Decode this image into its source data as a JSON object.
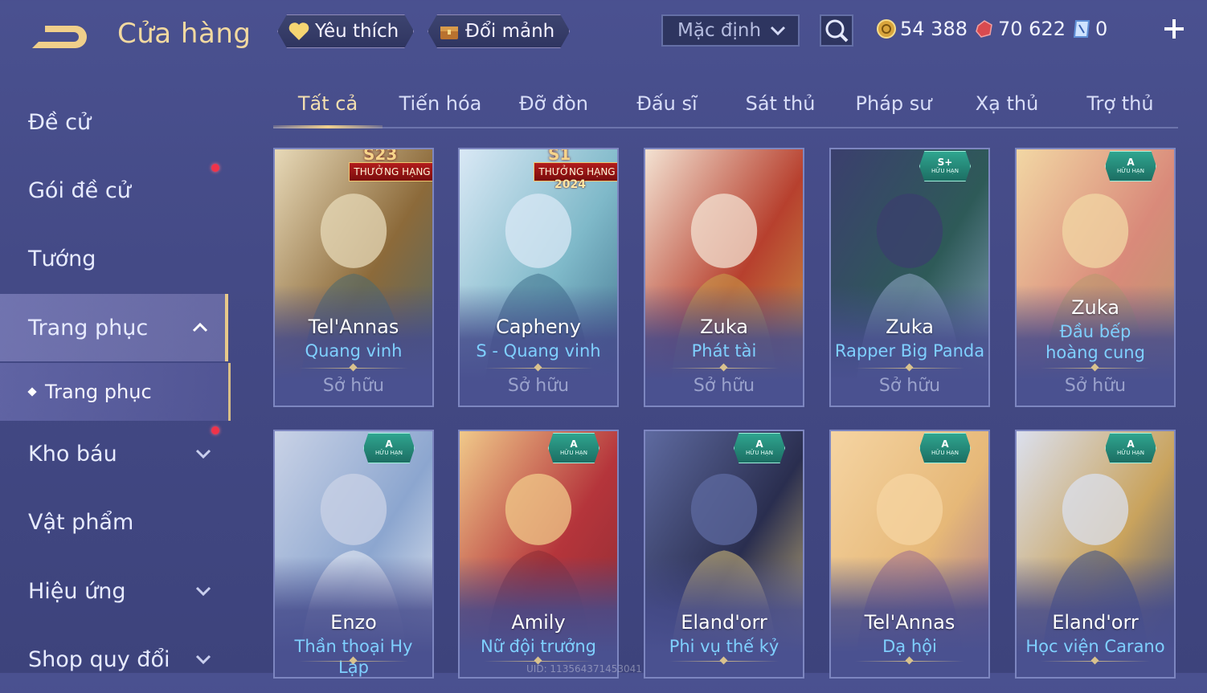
{
  "header": {
    "title": "Cửa hàng",
    "favorite_label": "Yêu thích",
    "exchange_label": "Đổi mảnh",
    "sort_value": "Mặc định",
    "currencies": [
      {
        "icon": "gold-coin-icon",
        "value": "54 388"
      },
      {
        "icon": "ruby-gem-icon",
        "value": "70 622"
      },
      {
        "icon": "voucher-icon",
        "value": "0"
      }
    ]
  },
  "sidebar": {
    "items": [
      {
        "label": "Đề cử"
      },
      {
        "label": "Gói đề cử"
      },
      {
        "label": "Tướng"
      },
      {
        "label": "Trang phục"
      },
      {
        "label": "Kho báu"
      },
      {
        "label": "Vật phẩm"
      },
      {
        "label": "Hiệu ứng"
      },
      {
        "label": "Shop quy đổi"
      }
    ],
    "sub_item": "Trang phục"
  },
  "tabs": [
    "Tất cả",
    "Tiến hóa",
    "Đỡ đòn",
    "Đấu sĩ",
    "Sát thủ",
    "Pháp sư",
    "Xạ thủ",
    "Trợ thủ"
  ],
  "cards": [
    {
      "hero": "Tel'Annas",
      "skin": "Quang vinh",
      "status": "Sở hữu",
      "banner_top": "S23",
      "banner": "THƯỞNG HẠNG",
      "colors": [
        "#e7d9b8",
        "#8c6a3a",
        "#4b6a6f"
      ]
    },
    {
      "hero": "Capheny",
      "skin": "S - Quang vinh",
      "status": "Sở hữu",
      "banner_top": "S1",
      "banner": "THƯỞNG HẠNG",
      "banner_sub": "2024",
      "colors": [
        "#d9e8f5",
        "#7fb9c9",
        "#3e6f8a"
      ]
    },
    {
      "hero": "Zuka",
      "skin": "Phát tài",
      "status": "Sở hữu",
      "colors": [
        "#f3e2d2",
        "#b7402e",
        "#c9a24a"
      ]
    },
    {
      "hero": "Zuka",
      "skin": "Rapper Big Panda",
      "status": "Sở hữu",
      "badge": "S+",
      "colors": [
        "#3b3f6e",
        "#2e5a58",
        "#8fa8c6"
      ]
    },
    {
      "hero": "Zuka",
      "skin": "Đầu bếp hoàng cung",
      "status": "Sở hữu",
      "badge": "A",
      "colors": [
        "#f2d7a4",
        "#d98a7a",
        "#b79a6d"
      ]
    },
    {
      "hero": "Enzo",
      "skin": "Thần thoại Hy Lạp",
      "badge": "A",
      "colors": [
        "#c9d2e6",
        "#8ca6cf",
        "#eef0f5"
      ]
    },
    {
      "hero": "Amily",
      "skin": "Nữ đội trưởng",
      "badge": "A",
      "colors": [
        "#f0c98a",
        "#b5353b",
        "#8a2b34"
      ]
    },
    {
      "hero": "Eland'orr",
      "skin": "Phi vụ thế kỷ",
      "badge": "A",
      "colors": [
        "#5e6aa0",
        "#2a2e4f",
        "#d7c07a"
      ]
    },
    {
      "hero": "Tel'Annas",
      "skin": "Dạ hội",
      "badge": "A",
      "colors": [
        "#f5d4a2",
        "#e6b878",
        "#9b6a8e"
      ]
    },
    {
      "hero": "Eland'orr",
      "skin": "Học viện Carano",
      "badge": "A",
      "colors": [
        "#dbe0ee",
        "#c9a35d",
        "#344a86"
      ]
    }
  ],
  "badge_sub": "HỮU HẠN",
  "footer_uid": "UID: 113564371453041"
}
